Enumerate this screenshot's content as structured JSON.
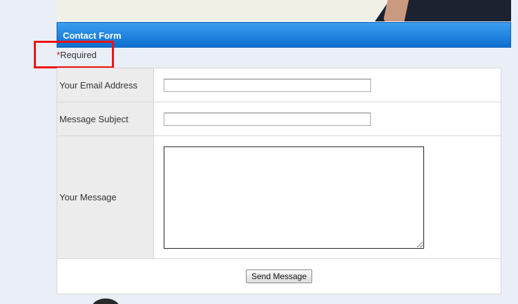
{
  "form": {
    "title": "Contact Form",
    "required_star": "*",
    "required_label": "Required",
    "fields": {
      "email_label": "Your Email Address",
      "email_value": "",
      "subject_label": "Message Subject",
      "subject_value": "",
      "message_label": "Your Message",
      "message_value": ""
    },
    "submit_label": "Send Message"
  },
  "colors": {
    "header_blue": "#0d6fcf",
    "highlight_red": "#ee1111",
    "required_star": "#e00000"
  }
}
